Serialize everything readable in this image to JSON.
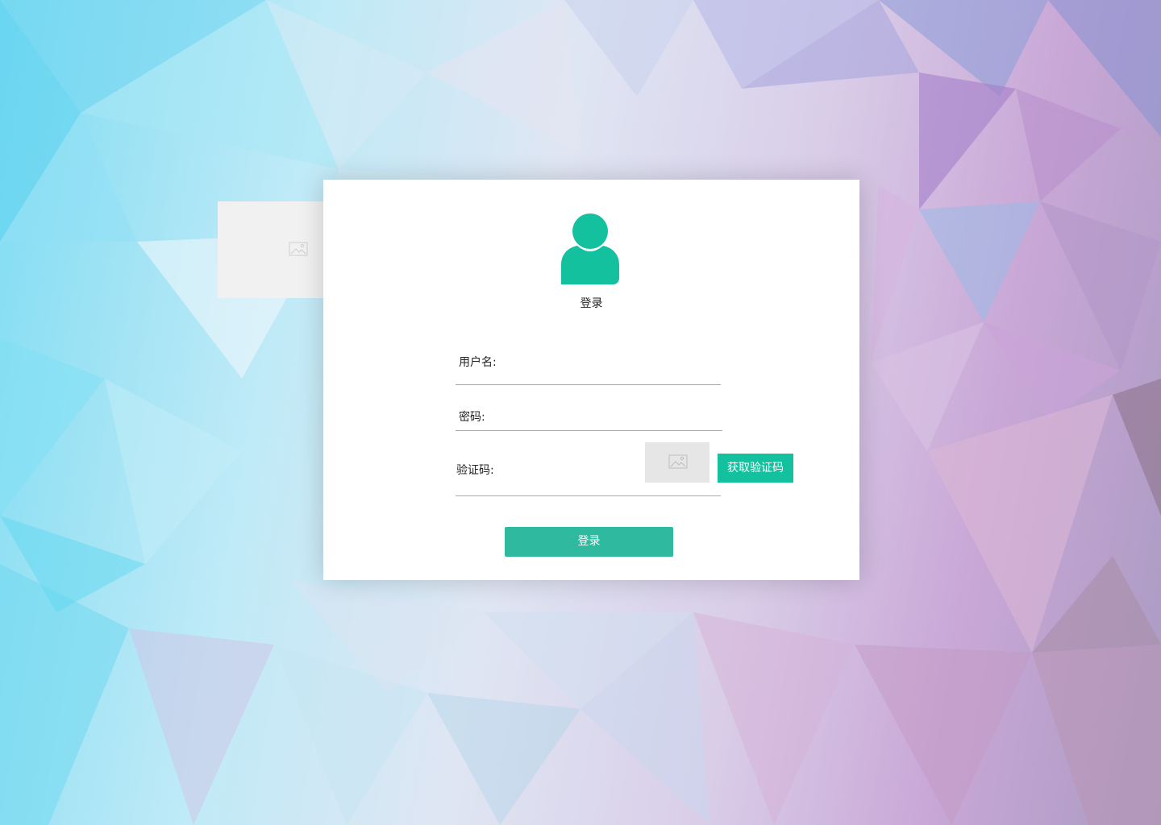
{
  "colors": {
    "accent": "#14c19e",
    "login_button": "#2fbaa0",
    "card_background": "#ffffff"
  },
  "background": {
    "placeholder_icon": "image-placeholder-icon"
  },
  "login_card": {
    "avatar_icon": "user-avatar-icon",
    "title": "登录",
    "username": {
      "label": "用户名:",
      "value": "",
      "placeholder": ""
    },
    "password": {
      "label": "密码:",
      "value": "",
      "placeholder": ""
    },
    "captcha": {
      "label": "验证码:",
      "value": "",
      "placeholder": "",
      "image_icon": "image-placeholder-icon",
      "get_code_label": "获取验证码"
    },
    "login_button_label": "登录"
  }
}
